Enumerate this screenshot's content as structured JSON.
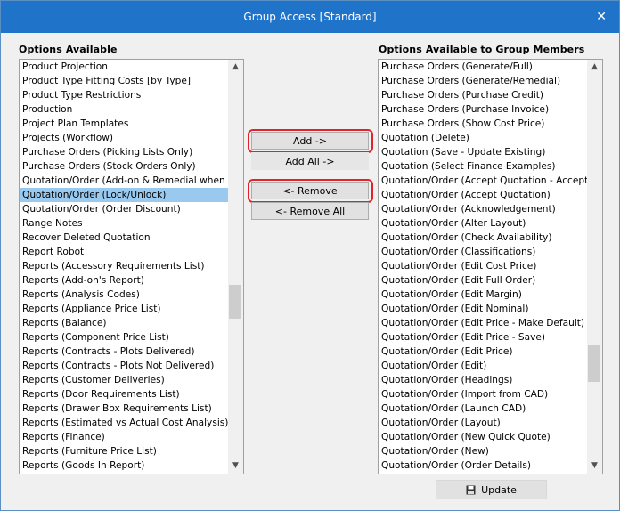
{
  "window": {
    "title": "Group Access [Standard]",
    "close_glyph": "✕"
  },
  "left": {
    "label": "Options Available",
    "items": [
      "Product Projection",
      "Product Type Fitting Costs [by Type]",
      "Product Type Restrictions",
      "Production",
      "Project Plan Templates",
      "Projects (Workflow)",
      "Purchase Orders (Picking Lists Only)",
      "Purchase Orders (Stock Orders Only)",
      "Quotation/Order (Add-on & Remedial when Locked)",
      "Quotation/Order (Lock/Unlock)",
      "Quotation/Order (Order Discount)",
      "Range Notes",
      "Recover Deleted Quotation",
      "Report Robot",
      "Reports (Accessory Requirements List)",
      "Reports (Add-on's Report)",
      "Reports (Analysis Codes)",
      "Reports (Appliance Price List)",
      "Reports (Balance)",
      "Reports (Component Price List)",
      "Reports (Contracts - Plots Delivered)",
      "Reports (Contracts - Plots Not Delivered)",
      "Reports (Customer Deliveries)",
      "Reports (Door Requirements List)",
      "Reports (Drawer Box Requirements List)",
      "Reports (Estimated vs Actual Cost Analysis)",
      "Reports (Finance)",
      "Reports (Furniture Price List)",
      "Reports (Goods In Report)"
    ],
    "selected_index": 9,
    "scroll_position": 0.55
  },
  "right": {
    "label": "Options Available to Group Members",
    "items": [
      "Purchase Orders (Generate/Full)",
      "Purchase Orders (Generate/Remedial)",
      "Purchase Orders (Purchase Credit)",
      "Purchase Orders (Purchase Invoice)",
      "Purchase Orders (Show Cost Price)",
      "Quotation (Delete)",
      "Quotation (Save - Update Existing)",
      "Quotation (Select Finance Examples)",
      "Quotation/Order (Accept Quotation - Accept Deposit)",
      "Quotation/Order (Accept Quotation)",
      "Quotation/Order (Acknowledgement)",
      "Quotation/Order (Alter Layout)",
      "Quotation/Order (Check Availability)",
      "Quotation/Order (Classifications)",
      "Quotation/Order (Edit Cost Price)",
      "Quotation/Order (Edit Full Order)",
      "Quotation/Order (Edit Margin)",
      "Quotation/Order (Edit Nominal)",
      "Quotation/Order (Edit Price - Make Default)",
      "Quotation/Order (Edit Price - Save)",
      "Quotation/Order (Edit Price)",
      "Quotation/Order (Edit)",
      "Quotation/Order (Headings)",
      "Quotation/Order (Import from CAD)",
      "Quotation/Order (Launch CAD)",
      "Quotation/Order (Layout)",
      "Quotation/Order (New Quick Quote)",
      "Quotation/Order (New)",
      "Quotation/Order (Order Details)"
    ],
    "scroll_position": 0.8
  },
  "buttons": {
    "add": "Add ->",
    "add_all": "Add All ->",
    "remove": "<- Remove",
    "remove_all": "<- Remove All",
    "update": "Update"
  },
  "icons": {
    "close": "close-icon",
    "update": "floppy-disk-icon",
    "scroll_up": "chevron-up-icon",
    "scroll_down": "chevron-down-icon"
  },
  "colors": {
    "titlebar": "#1f73c9",
    "selection": "#99c9ef",
    "highlight_outline": "#e0242c"
  }
}
